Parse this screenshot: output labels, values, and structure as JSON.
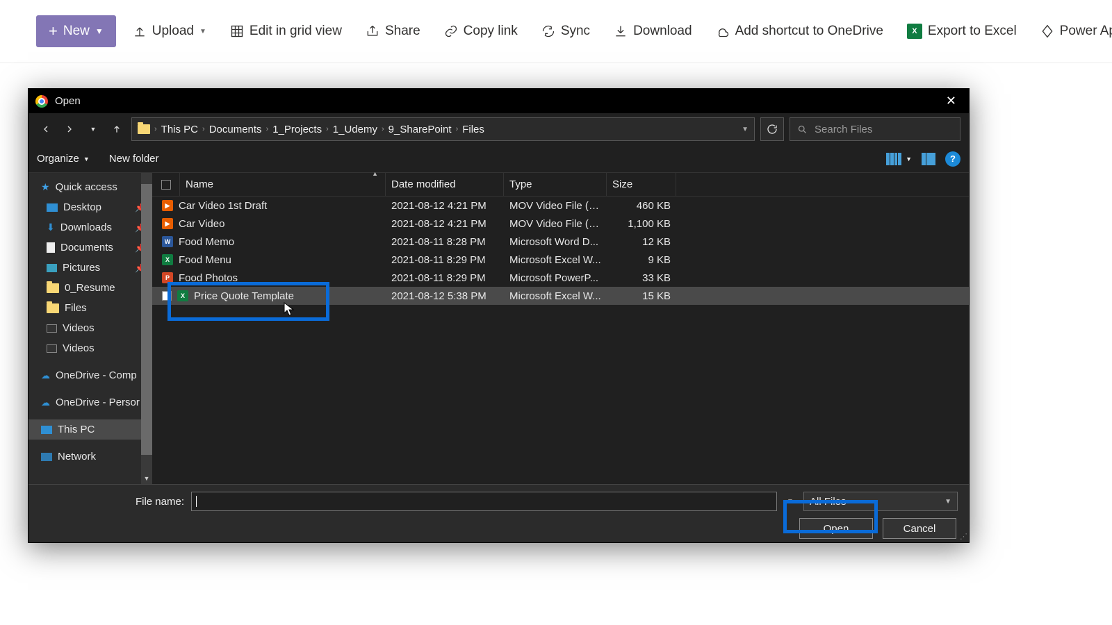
{
  "sharepoint": {
    "new": "New",
    "upload": "Upload",
    "edit_grid": "Edit in grid view",
    "share": "Share",
    "copy_link": "Copy link",
    "sync": "Sync",
    "download": "Download",
    "add_shortcut": "Add shortcut to OneDrive",
    "export_excel": "Export to Excel",
    "power_apps": "Power Apps"
  },
  "dialog": {
    "title": "Open",
    "organize": "Organize",
    "new_folder": "New folder",
    "breadcrumbs": [
      "This PC",
      "Documents",
      "1_Projects",
      "1_Udemy",
      "9_SharePoint",
      "Files"
    ],
    "search_placeholder": "Search Files",
    "columns": {
      "name": "Name",
      "date": "Date modified",
      "type": "Type",
      "size": "Size"
    },
    "file_name_label": "File name:",
    "filter": "All Files",
    "open_btn": "Open",
    "cancel_btn": "Cancel"
  },
  "sidebar": {
    "quick_access": "Quick access",
    "desktop": "Desktop",
    "downloads": "Downloads",
    "documents": "Documents",
    "pictures": "Pictures",
    "resume": "0_Resume",
    "files": "Files",
    "videos1": "Videos",
    "videos2": "Videos",
    "onedrive_comp": "OneDrive - Comp",
    "onedrive_pers": "OneDrive - Persor",
    "this_pc": "This PC",
    "network": "Network"
  },
  "files": [
    {
      "name": "Car Video 1st Draft",
      "date": "2021-08-12 4:21 PM",
      "type": "MOV Video File (V...",
      "size": "460 KB",
      "icon": "mov"
    },
    {
      "name": "Car Video",
      "date": "2021-08-12 4:21 PM",
      "type": "MOV Video File (V...",
      "size": "1,100 KB",
      "icon": "mov"
    },
    {
      "name": "Food Memo",
      "date": "2021-08-11 8:28 PM",
      "type": "Microsoft Word D...",
      "size": "12 KB",
      "icon": "word"
    },
    {
      "name": "Food Menu",
      "date": "2021-08-11 8:29 PM",
      "type": "Microsoft Excel W...",
      "size": "9 KB",
      "icon": "xl"
    },
    {
      "name": "Food Photos",
      "date": "2021-08-11 8:29 PM",
      "type": "Microsoft PowerP...",
      "size": "33 KB",
      "icon": "ppt"
    },
    {
      "name": "Price Quote Template",
      "date": "2021-08-12 5:38 PM",
      "type": "Microsoft Excel W...",
      "size": "15 KB",
      "icon": "xl"
    }
  ]
}
